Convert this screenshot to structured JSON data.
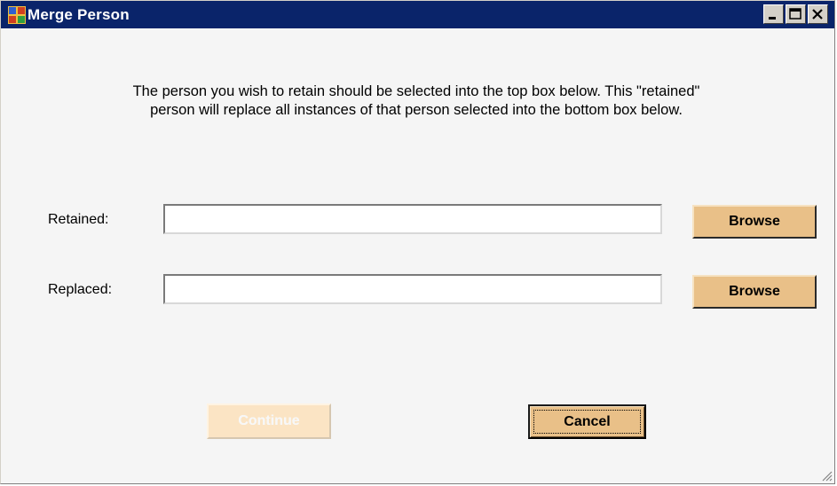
{
  "window": {
    "title": "Merge Person",
    "icon": "merge-app-icon",
    "controls": [
      "minimize-icon",
      "maximize-icon",
      "close-icon"
    ]
  },
  "instructions": {
    "line1": "The person you wish to retain should be selected into the top box below.  This \"retained\"",
    "line2": "person will replace all instances of that person selected into the bottom box below."
  },
  "fields": {
    "retained": {
      "label": "Retained:",
      "value": "",
      "browse_label": "Browse"
    },
    "replaced": {
      "label": "Replaced:",
      "value": "",
      "browse_label": "Browse"
    }
  },
  "actions": {
    "continue_label": "Continue",
    "continue_enabled": false,
    "cancel_label": "Cancel"
  },
  "colors": {
    "titlebar": "#0a246a",
    "button_face": "#e9c088",
    "button_disabled": "#fbe4c4",
    "window_bg": "#f5f5f5"
  }
}
